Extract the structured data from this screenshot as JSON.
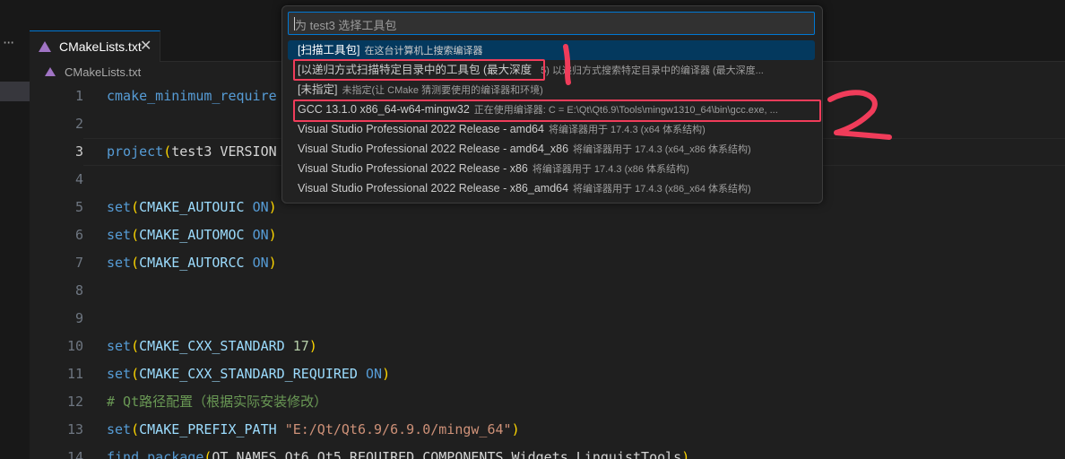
{
  "tab": {
    "label": "CMakeLists.txt",
    "close": "✕"
  },
  "breadcrumb": {
    "file": "CMakeLists.txt"
  },
  "editor": {
    "lines": [
      {
        "n": "1",
        "segs": [
          [
            "fn",
            "cmake_minimum_require"
          ]
        ]
      },
      {
        "n": "2",
        "segs": []
      },
      {
        "n": "3",
        "segs": [
          [
            "fn",
            "project"
          ],
          [
            "par",
            "("
          ],
          [
            "txt",
            "test3 VERSION"
          ]
        ]
      },
      {
        "n": "4",
        "segs": []
      },
      {
        "n": "5",
        "segs": [
          [
            "fn",
            "set"
          ],
          [
            "par",
            "("
          ],
          [
            "var",
            "CMAKE_AUTOUIC"
          ],
          [
            "txt",
            " "
          ],
          [
            "kw",
            "ON"
          ],
          [
            "par",
            ")"
          ]
        ]
      },
      {
        "n": "6",
        "segs": [
          [
            "fn",
            "set"
          ],
          [
            "par",
            "("
          ],
          [
            "var",
            "CMAKE_AUTOMOC"
          ],
          [
            "txt",
            " "
          ],
          [
            "kw",
            "ON"
          ],
          [
            "par",
            ")"
          ]
        ]
      },
      {
        "n": "7",
        "segs": [
          [
            "fn",
            "set"
          ],
          [
            "par",
            "("
          ],
          [
            "var",
            "CMAKE_AUTORCC"
          ],
          [
            "txt",
            " "
          ],
          [
            "kw",
            "ON"
          ],
          [
            "par",
            ")"
          ]
        ]
      },
      {
        "n": "8",
        "segs": []
      },
      {
        "n": "9",
        "segs": []
      },
      {
        "n": "10",
        "segs": [
          [
            "fn",
            "set"
          ],
          [
            "par",
            "("
          ],
          [
            "var",
            "CMAKE_CXX_STANDARD"
          ],
          [
            "txt",
            " "
          ],
          [
            "num",
            "17"
          ],
          [
            "par",
            ")"
          ]
        ]
      },
      {
        "n": "11",
        "segs": [
          [
            "fn",
            "set"
          ],
          [
            "par",
            "("
          ],
          [
            "var",
            "CMAKE_CXX_STANDARD_REQUIRED"
          ],
          [
            "txt",
            " "
          ],
          [
            "kw",
            "ON"
          ],
          [
            "par",
            ")"
          ]
        ]
      },
      {
        "n": "12",
        "segs": [
          [
            "cmt",
            "# Qt路径配置（根据实际安装修改）"
          ]
        ]
      },
      {
        "n": "13",
        "segs": [
          [
            "fn",
            "set"
          ],
          [
            "par",
            "("
          ],
          [
            "var",
            "CMAKE_PREFIX_PATH"
          ],
          [
            "txt",
            " "
          ],
          [
            "str",
            "\"E:/Qt/Qt6.9/6.9.0/mingw_64\""
          ],
          [
            "par",
            ")"
          ]
        ]
      },
      {
        "n": "14",
        "segs": [
          [
            "fn",
            "find_package"
          ],
          [
            "par",
            "("
          ],
          [
            "txt",
            "QT NAMES Qt6 Qt5 REQUIRED COMPONENTS Widgets LinguistTools"
          ],
          [
            "par",
            ")"
          ]
        ]
      }
    ]
  },
  "quickpick": {
    "placeholder": "为 test3 选择工具包",
    "items": [
      {
        "label": "[扫描工具包]",
        "desc": "在这台计算机上搜索编译器"
      },
      {
        "label": "[以递归方式扫描特定目录中的工具包 (最大深度",
        "desc": "5)  以递归方式搜索特定目录中的编译器 (最大深度..."
      },
      {
        "label": "[未指定]",
        "desc": "未指定(让 CMake 猜测要使用的编译器和环境)"
      },
      {
        "label": "GCC 13.1.0 x86_64-w64-mingw32",
        "desc": "正在使用编译器: C = E:\\Qt\\Qt6.9\\Tools\\mingw1310_64\\bin\\gcc.exe, ..."
      },
      {
        "label": "Visual Studio Professional 2022 Release - amd64",
        "desc": "将编译器用于 17.4.3 (x64 体系结构)"
      },
      {
        "label": "Visual Studio Professional 2022 Release - amd64_x86",
        "desc": "将编译器用于 17.4.3 (x64_x86 体系结构)"
      },
      {
        "label": "Visual Studio Professional 2022 Release - x86",
        "desc": "将编译器用于 17.4.3 (x86 体系结构)"
      },
      {
        "label": "Visual Studio Professional 2022 Release - x86_amd64",
        "desc": "将编译器用于 17.4.3 (x86_x64 体系结构)"
      }
    ]
  },
  "annotations": {
    "mark1": "1",
    "mark2": "2",
    "color": "#f03c5a"
  },
  "colors": {
    "accent": "#0078d4",
    "selection": "#04395e",
    "cmake_icon": "#a074c4"
  }
}
